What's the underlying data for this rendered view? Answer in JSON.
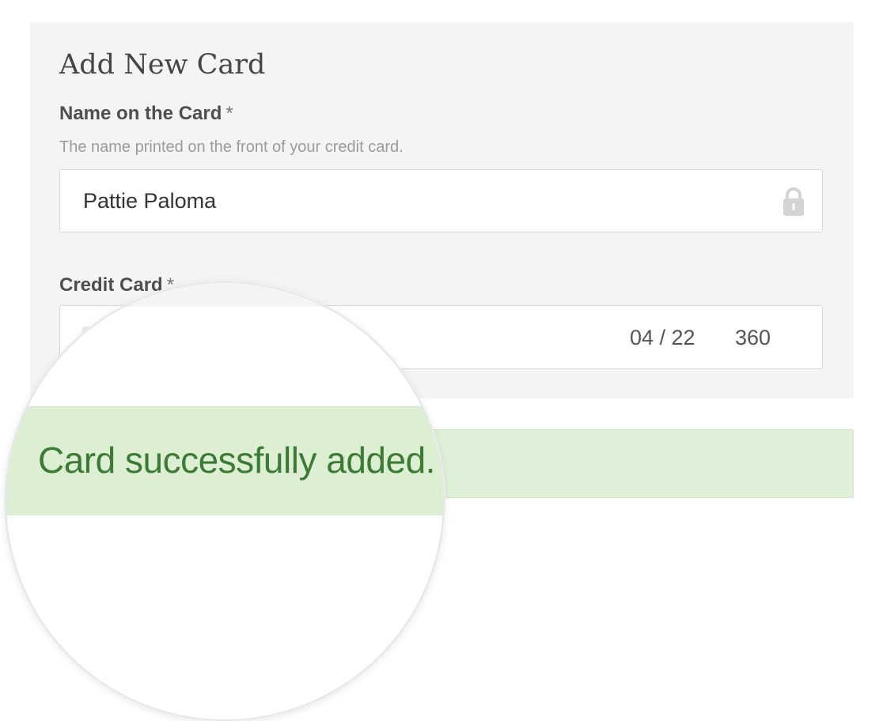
{
  "form": {
    "title": "Add New Card",
    "name_label": "Name on the Card",
    "name_required_mark": "*",
    "name_hint": "The name printed on the front of your credit card.",
    "name_value": "Pattie Paloma",
    "card_label": "Credit Card",
    "card_required_mark": "*",
    "card_expiry": "04 / 22",
    "card_cvc": "360"
  },
  "alert": {
    "message": "Card successfully added."
  },
  "icons": {
    "name_field_icon": "lock-icon",
    "card_brand_icon": "card-brand-icon"
  },
  "colors": {
    "panel_background": "#f4f4f4",
    "success_background": "#dff0d8",
    "success_text": "#3c7a35"
  }
}
